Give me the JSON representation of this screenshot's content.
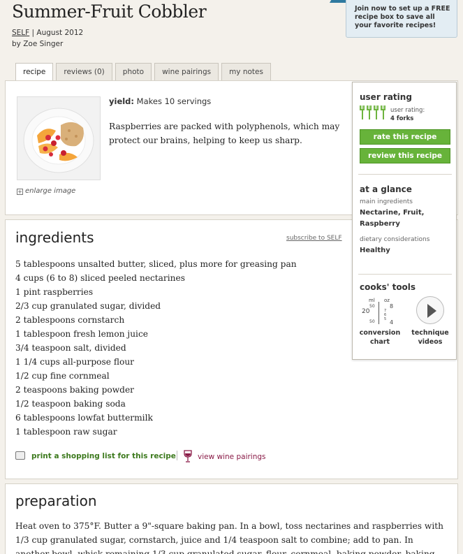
{
  "recipe": {
    "title": "Summer-Fruit Cobbler",
    "source": "SELF",
    "date": "| August 2012",
    "author": "by Zoe Singer"
  },
  "promo": {
    "text": "Join now to set up a FREE recipe box to save all your favorite recipes!"
  },
  "tabs": [
    {
      "label": "recipe"
    },
    {
      "label": "reviews (0)"
    },
    {
      "label": "photo"
    },
    {
      "label": "wine pairings"
    },
    {
      "label": "my notes"
    }
  ],
  "summary": {
    "yield_label": "yield:",
    "yield_value": "Makes 10 servings",
    "description": "Raspberries are packed with polyphenols, which may protect our brains, helping to keep us sharp.",
    "enlarge_label": "enlarge image"
  },
  "sidebar": {
    "rating_title": "user rating",
    "rating_label": "user rating:",
    "rating_value": "4 forks",
    "rating_forks": 4,
    "rate_button": "rate this recipe",
    "review_button": "review this recipe",
    "glance_title": "at a glance",
    "main_ingredients_label": "main ingredients",
    "main_ingredients_1": "Nectarine,  Fruit,",
    "main_ingredients_2": "Raspberry",
    "dietary_label": "dietary considerations",
    "dietary_value": "Healthy",
    "tools_title": "cooks' tools",
    "conversion_label_1": "conversion",
    "conversion_label_2": "chart",
    "video_label_1": "technique",
    "video_label_2": "videos",
    "conv_ml": "ml",
    "conv_oz": "oz",
    "conv_20": "20",
    "conv_8": "8",
    "conv_4": "4",
    "conv_50a": "50",
    "conv_50b": "50",
    "conv_7": "7",
    "conv_6": "6",
    "conv_5": "5"
  },
  "ingredients_section": {
    "title": "ingredients",
    "subscribe": "subscribe to SELF",
    "items": [
      "5 tablespoons unsalted butter, sliced, plus more for greasing pan",
      "4 cups (6 to 8) sliced peeled nectarines",
      "1 pint raspberries",
      "2/3 cup granulated sugar, divided",
      "2 tablespoons cornstarch",
      "1 tablespoon fresh lemon juice",
      "3/4 teaspoon salt, divided",
      "1 1/4 cups all-purpose flour",
      "1/2 cup fine cornmeal",
      "2 teaspoons baking powder",
      "1/2 teaspoon baking soda",
      "6 tablespoons lowfat buttermilk",
      "1 tablespoon raw sugar"
    ],
    "shopping_link": "print a shopping list for this recipe",
    "wine_link": "view wine pairings"
  },
  "preparation": {
    "title": "preparation",
    "text": "Heat oven to 375°F. Butter a 9\"-square baking pan. In a bowl, toss nectarines and raspberries with 1/3 cup granulated sugar, cornstarch, juice and 1/4 teaspoon salt to combine; add to pan. In another bowl, whisk remaining 1/3 cup granulated sugar, flour, cornmeal, baking powder, baking soda and remaining salt."
  },
  "colors": {
    "accent_green": "#67b33a",
    "wine_red": "#8a1b47",
    "link_green": "#3d7a1e"
  }
}
